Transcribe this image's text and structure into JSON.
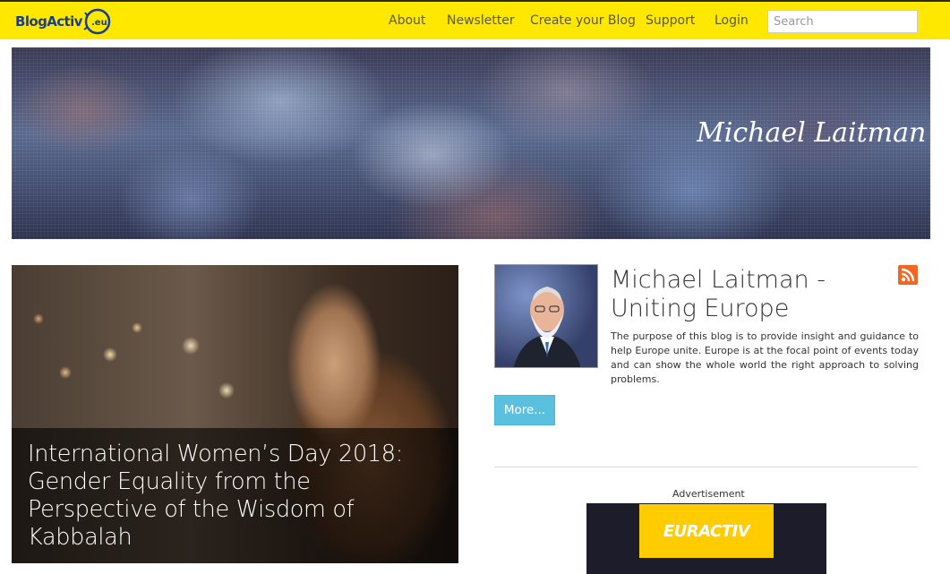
{
  "header": {
    "logo_text": "BlogActiv",
    "logo_badge": ".eu",
    "nav": [
      {
        "label": "About"
      },
      {
        "label": "Newsletter"
      },
      {
        "label": "Create your Blog"
      },
      {
        "label": "Support"
      },
      {
        "label": "Login"
      }
    ],
    "search_placeholder": "Search"
  },
  "banner": {
    "signature": "Michael Laitman"
  },
  "feature": {
    "title": "International Women’s Day 2018: Gender Equality from the Perspective of the Wisdom of Kabbalah"
  },
  "blog": {
    "title_line1": "Michael Laitman -",
    "title_line2": "Uniting Europe",
    "description": "The purpose of this blog is to provide insight and guidance to help Europe unite. Europe is at the focal point of events today and can show the whole world the right approach to solving problems.",
    "more_label": "More..."
  },
  "ad": {
    "label": "Advertisement",
    "brand": "EURACTIV"
  },
  "colors": {
    "topbar": "#ffe800",
    "logo": "#1a3d8f",
    "more_button": "#5bc0de",
    "rss": "#f26522",
    "ad_yellow": "#ffcc00"
  }
}
